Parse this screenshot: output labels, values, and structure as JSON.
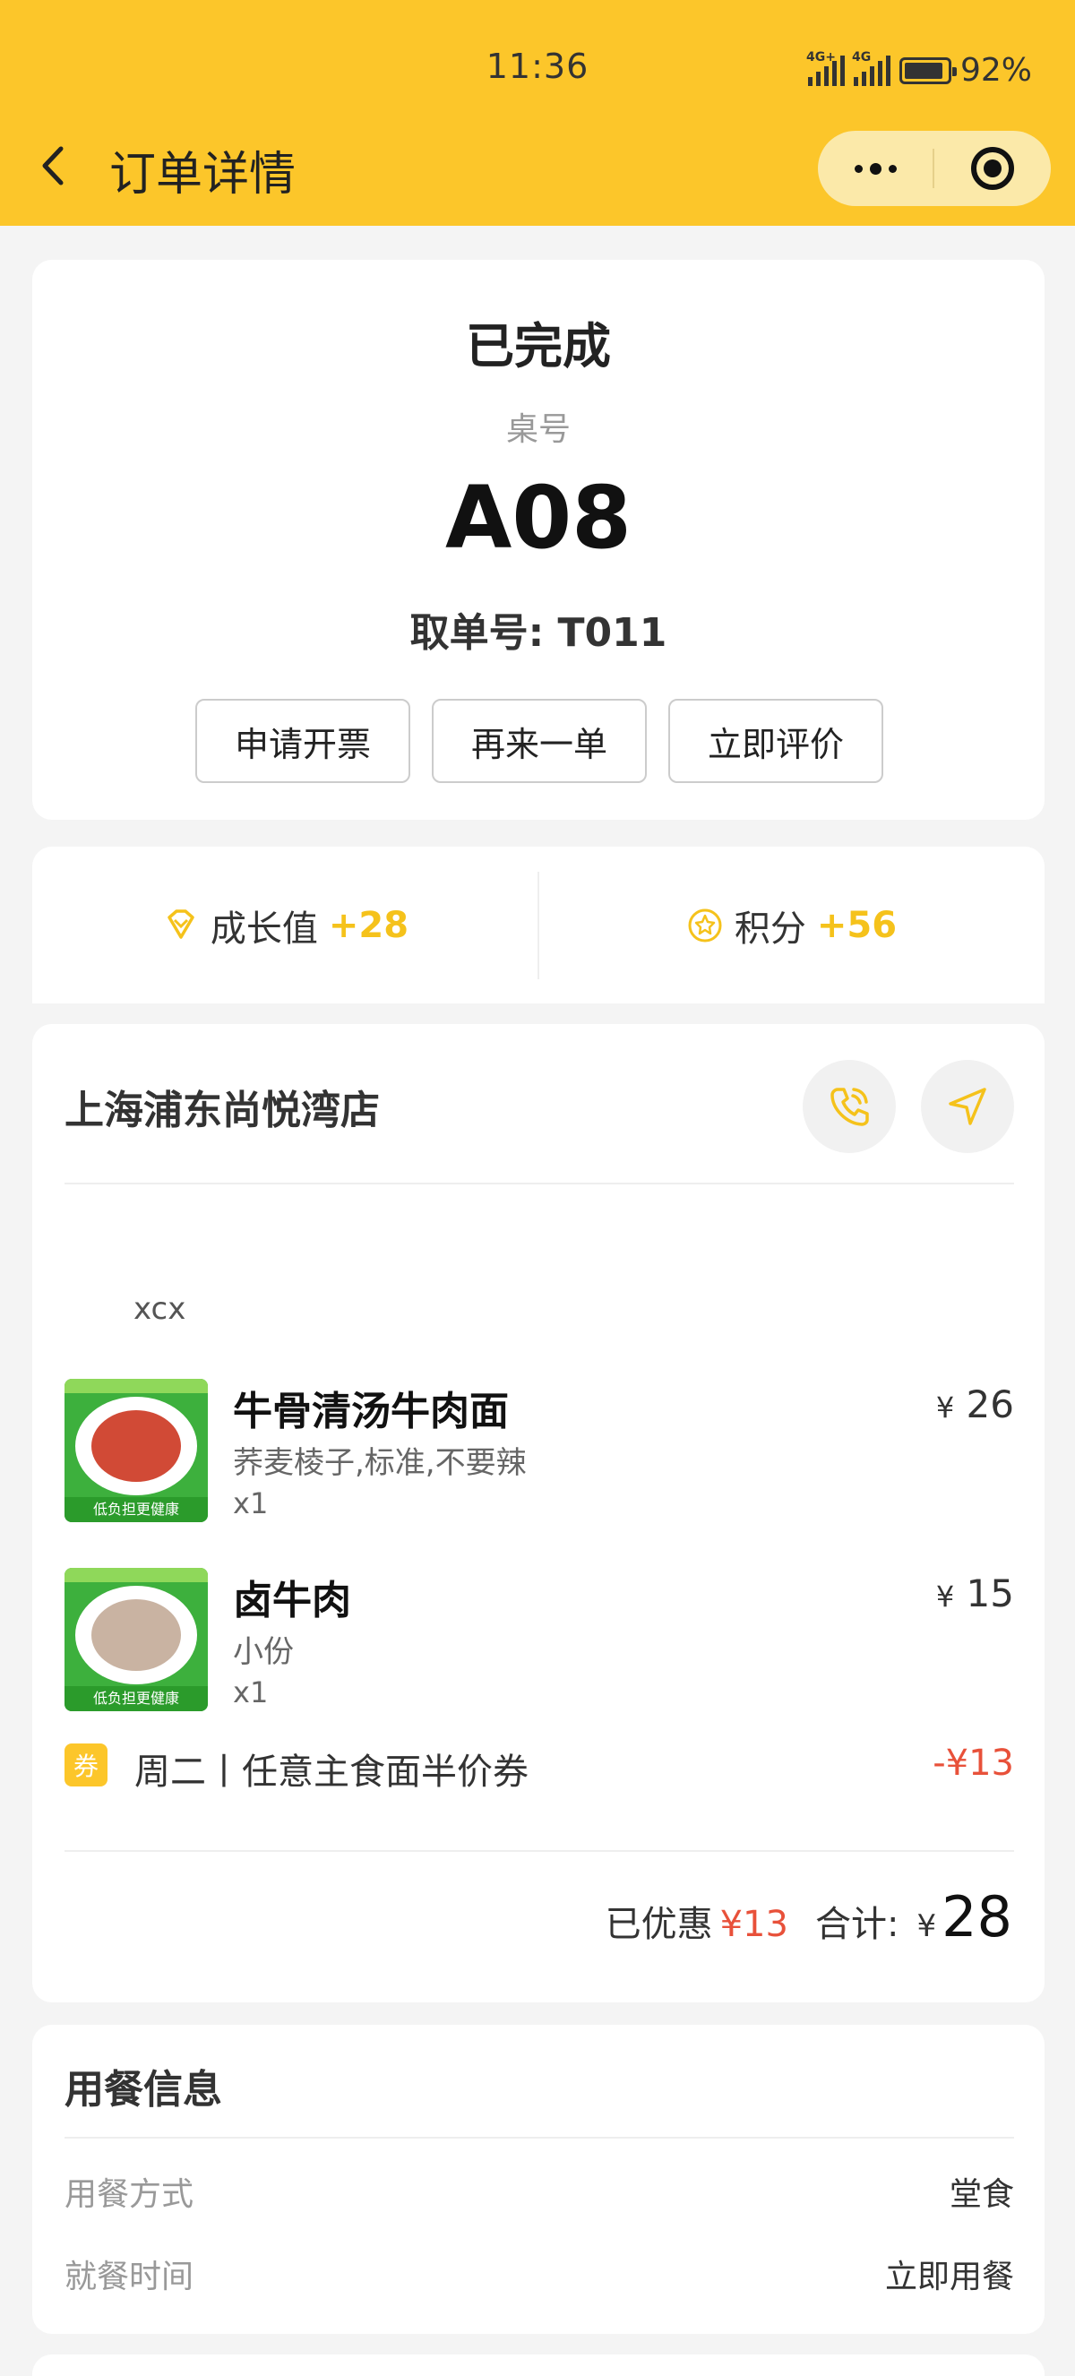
{
  "status_bar": {
    "time": "11:36",
    "network_1": "4G+",
    "network_2": "4G",
    "battery_percent": "92%",
    "battery_level": 0.92
  },
  "nav": {
    "title": "订单详情",
    "back_icon": "chevron-left-icon",
    "more_icon": "more-dots-icon",
    "close_icon": "target-circle-icon"
  },
  "order_status": {
    "status": "已完成",
    "table_label": "桌号",
    "table_no": "A08",
    "pickup": "取单号: T011",
    "actions": [
      "申请开票",
      "再来一单",
      "立即评价"
    ]
  },
  "rewards": {
    "growth_label": "成长值",
    "growth_value": "+28",
    "points_label": "积分",
    "points_value": "+56",
    "accent_color": "#f5c21b"
  },
  "order": {
    "store_name": "上海浦东尚悦湾店",
    "note": "xcx",
    "items": [
      {
        "name": "牛骨清汤牛肉面",
        "spec": "荞麦棱子,标准,不要辣",
        "qty": "x1",
        "currency": "¥",
        "price": "26",
        "thumb_band": "低负担更健康"
      },
      {
        "name": "卤牛肉",
        "spec": "小份",
        "qty": "x1",
        "currency": "¥",
        "price": "15",
        "thumb_band": "低负担更健康"
      }
    ],
    "coupon": {
      "badge": "券",
      "name": "周二丨任意主食面半价券",
      "amount": "-¥13"
    },
    "summary": {
      "discount_label": "已优惠",
      "discount_value": "¥13",
      "total_label": "合计:",
      "currency": "¥",
      "total_value": "28"
    }
  },
  "dining": {
    "title": "用餐信息",
    "rows": [
      {
        "key": "用餐方式",
        "value": "堂食"
      },
      {
        "key": "就餐时间",
        "value": "立即用餐"
      }
    ]
  }
}
